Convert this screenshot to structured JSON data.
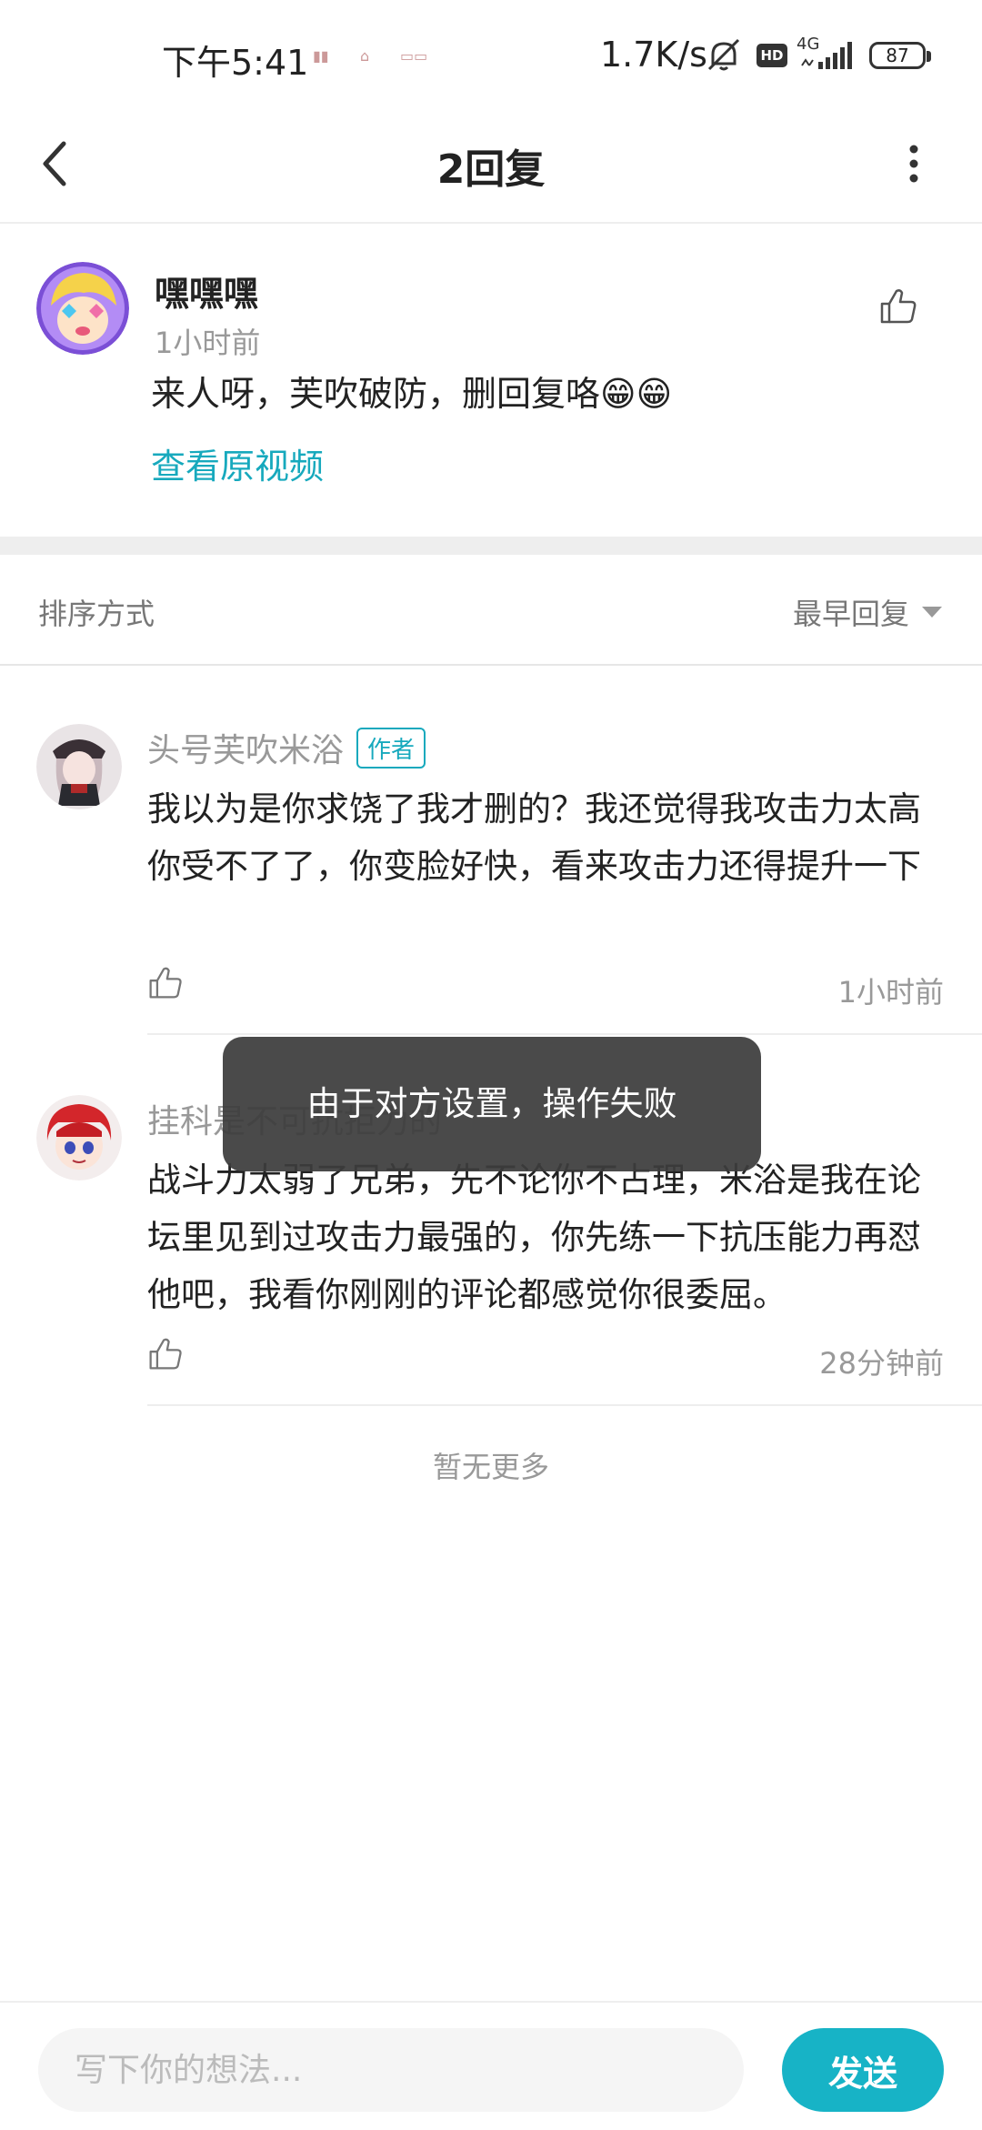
{
  "status_bar": {
    "time": "下午5:41",
    "net_speed": "1.7K/s",
    "network": "4G",
    "battery": "87",
    "hd_label": "HD"
  },
  "header": {
    "title": "2回复"
  },
  "original_comment": {
    "username": "嘿嘿嘿",
    "time": "1小时前",
    "text": "来人呀，芙吹破防，删回复咯😁😁",
    "view_video_link": "查看原视频"
  },
  "sort_bar": {
    "label": "排序方式",
    "selected": "最早回复"
  },
  "replies": [
    {
      "username": "头号芙吹米浴",
      "badge": "作者",
      "text": "我以为是你求饶了我才删的？我还觉得我攻击力太高你受不了了，你变脸好快，看来攻击力还得提升一下",
      "time": "1小时前"
    },
    {
      "username": "挂科是不可抗拒力的",
      "text": "战斗力太弱了兄弟，先不论你不占理，米浴是我在论坛里见到过攻击力最强的，你先练一下抗压能力再怼他吧，我看你刚刚的评论都感觉你很委屈。",
      "time": "28分钟前"
    }
  ],
  "no_more_text": "暂无更多",
  "toast": {
    "message": "由于对方设置，操作失败"
  },
  "bottom_bar": {
    "input_placeholder": "写下你的想法...",
    "send_label": "发送"
  },
  "colors": {
    "accent": "#17a9bd",
    "send_button": "#17b3c6",
    "toast_bg": "#3c3c3c"
  }
}
